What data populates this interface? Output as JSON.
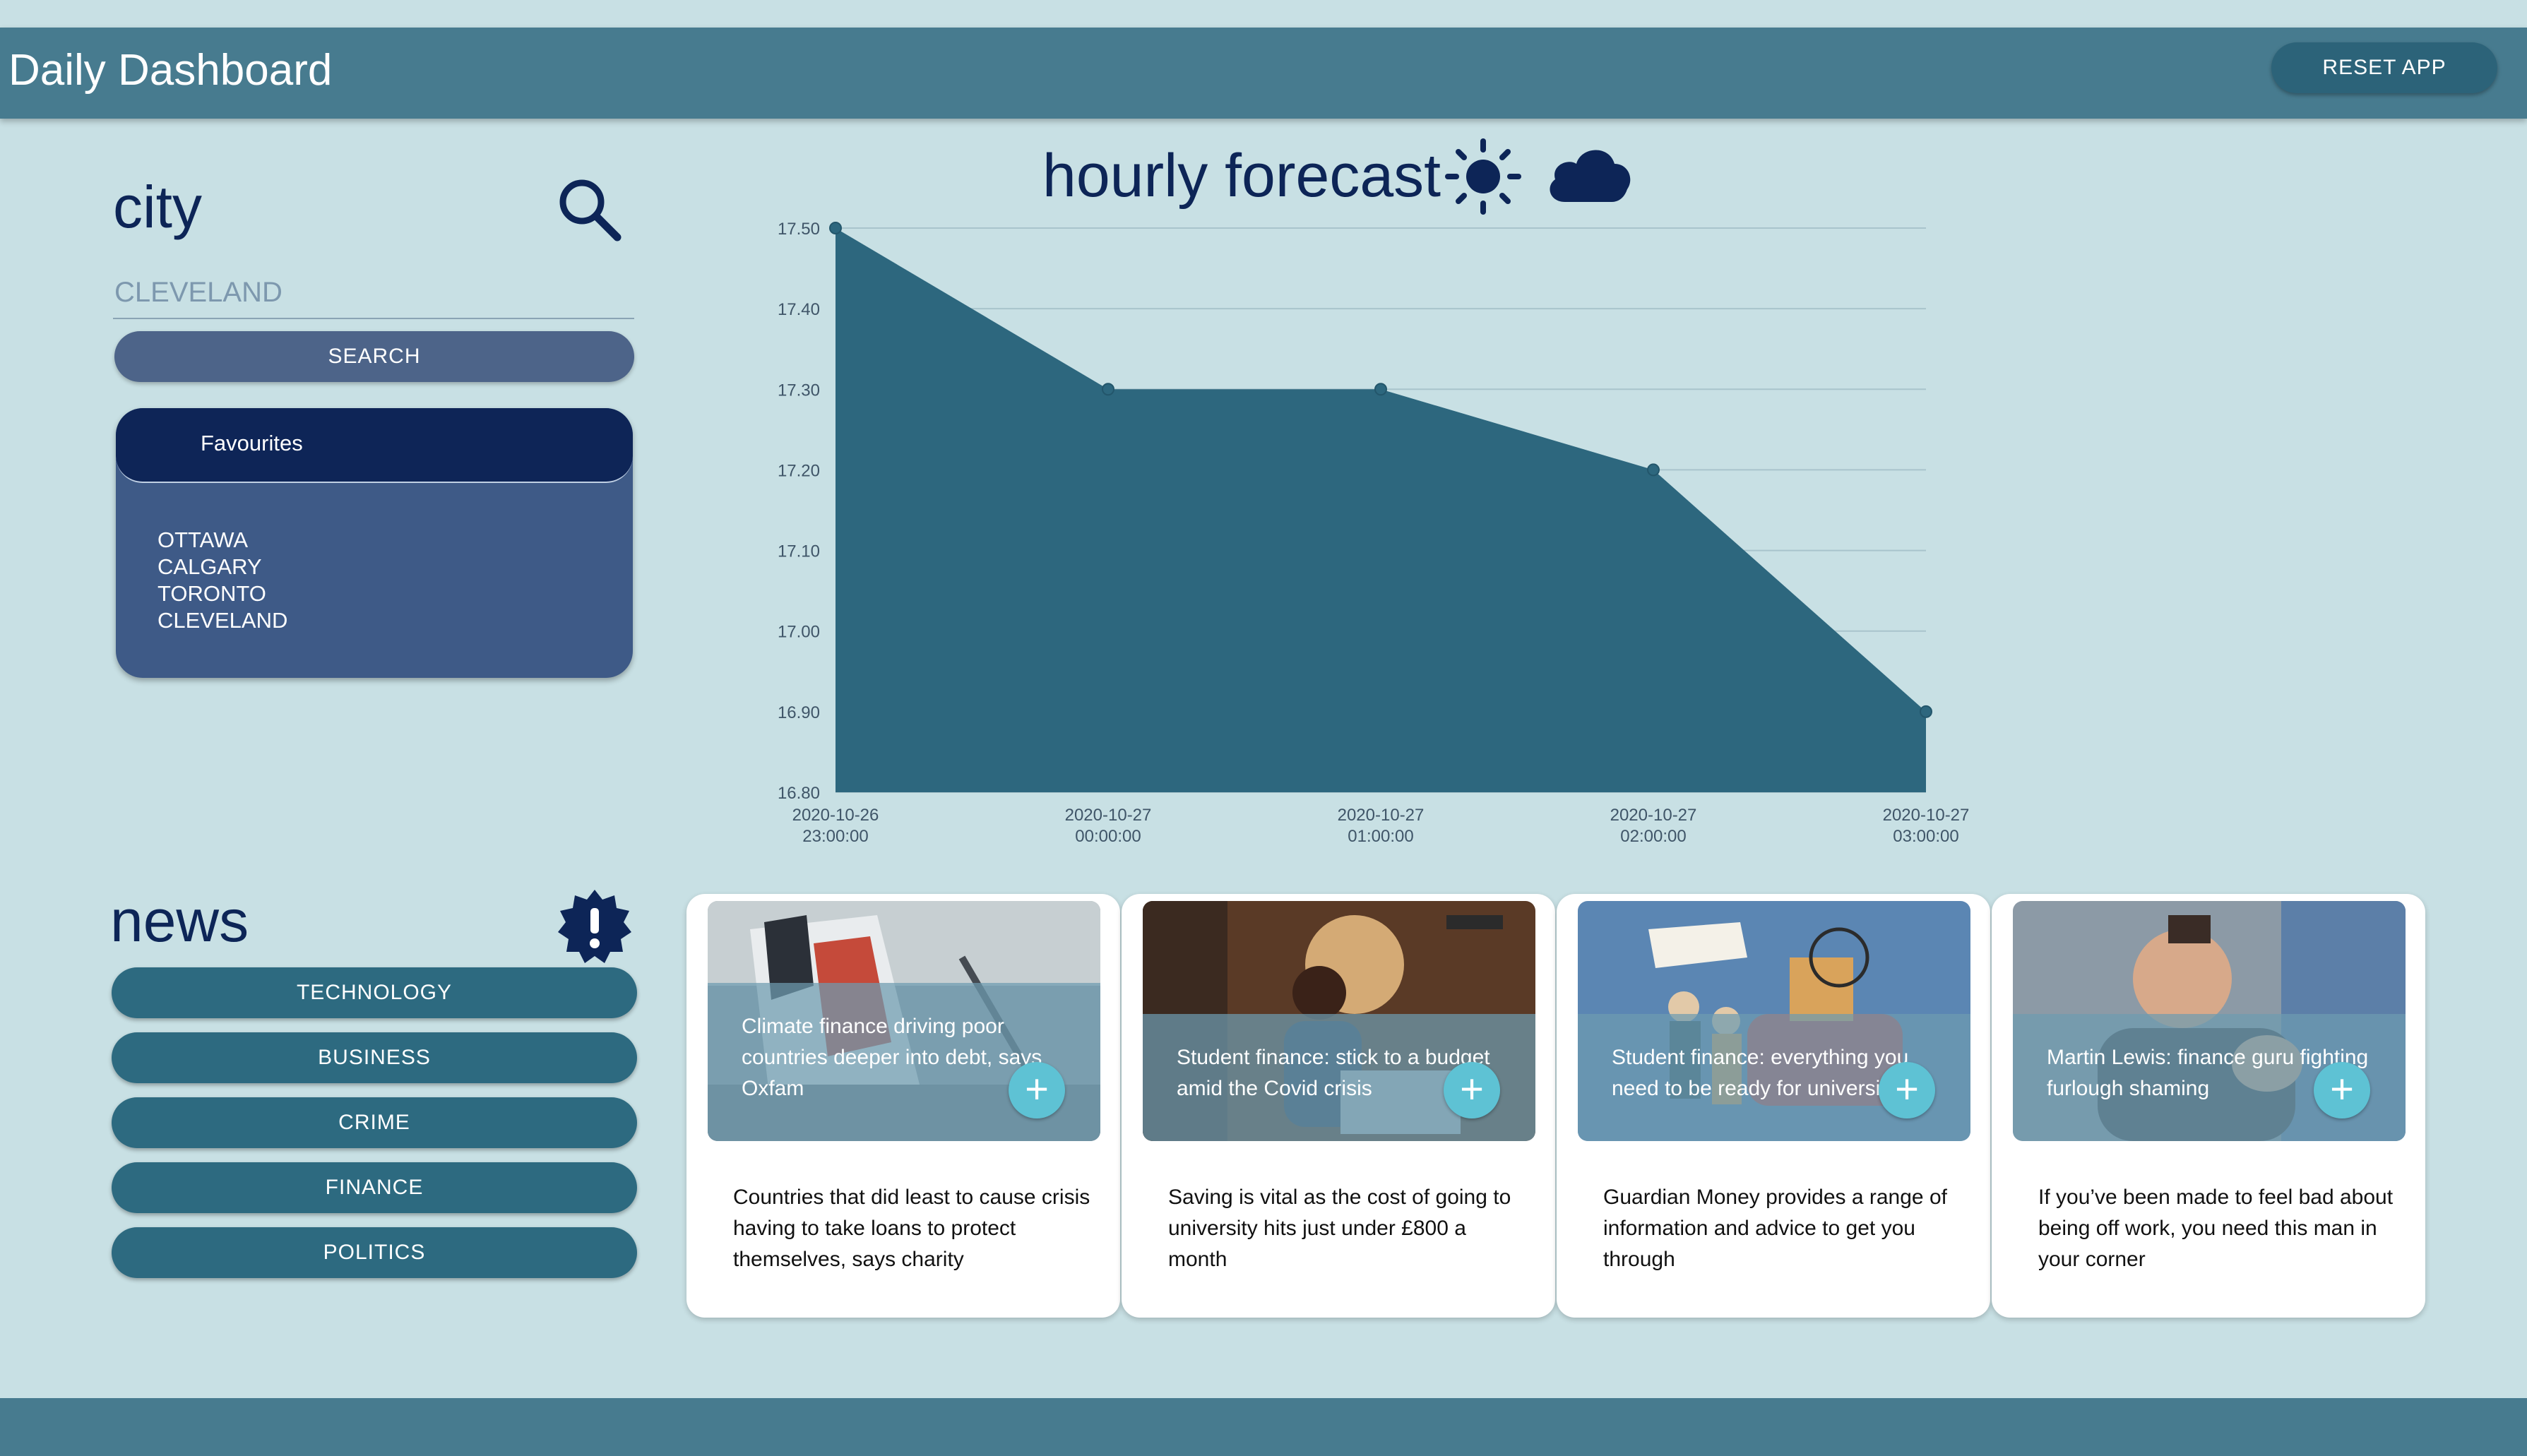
{
  "header": {
    "title": "Daily Dashboard",
    "reset_label": "RESET APP"
  },
  "city_panel": {
    "heading": "city",
    "input_value": "CLEVELAND",
    "search_label": "SEARCH",
    "favourites_title": "Favourites",
    "favourites": [
      "OTTAWA",
      "CALGARY",
      "TORONTO",
      "CLEVELAND"
    ]
  },
  "forecast": {
    "title": "hourly forecast",
    "icons": [
      "sun-icon",
      "cloud-icon"
    ]
  },
  "chart_data": {
    "type": "area",
    "title": "hourly forecast",
    "x": [
      "2020-10-26 23:00:00",
      "2020-10-27 00:00:00",
      "2020-10-27 01:00:00",
      "2020-10-27 02:00:00",
      "2020-10-27 03:00:00"
    ],
    "y_ticks": [
      "17.50",
      "17.40",
      "17.30",
      "17.20",
      "17.10",
      "17.00",
      "16.90",
      "16.80"
    ],
    "series": [
      {
        "values": [
          17.5,
          17.3,
          17.3,
          17.2,
          16.9
        ]
      }
    ],
    "ylim": [
      16.8,
      17.5
    ],
    "grid": true,
    "color": "#2d677e"
  },
  "news_panel": {
    "heading": "news",
    "icon": "alert-badge-icon",
    "categories": [
      "TECHNOLOGY",
      "BUSINESS",
      "CRIME",
      "FINANCE",
      "POLITICS"
    ]
  },
  "articles": [
    {
      "title": "Climate finance driving poor countries deeper into debt, says Oxfam",
      "summary": "Countries that did least to cause crisis having to take loans to protect themselves, says charity"
    },
    {
      "title": "Student finance: stick to a budget amid the Covid crisis",
      "summary": "Saving is vital as the cost of going to university hits just under £800 a month"
    },
    {
      "title": "Student finance: everything you need to be ready for university",
      "summary": "Guardian Money provides a range of information and advice to get you through"
    },
    {
      "title": "Martin Lewis: finance guru fighting furlough shaming",
      "summary": "If you’ve been made to feel bad about being off work, you need this man in your corner"
    }
  ],
  "add_symbol": "+",
  "colors": {
    "header": "#477b8f",
    "background": "#c8e0e4",
    "navy": "#0d2557",
    "accent": "#5ec2d4"
  }
}
